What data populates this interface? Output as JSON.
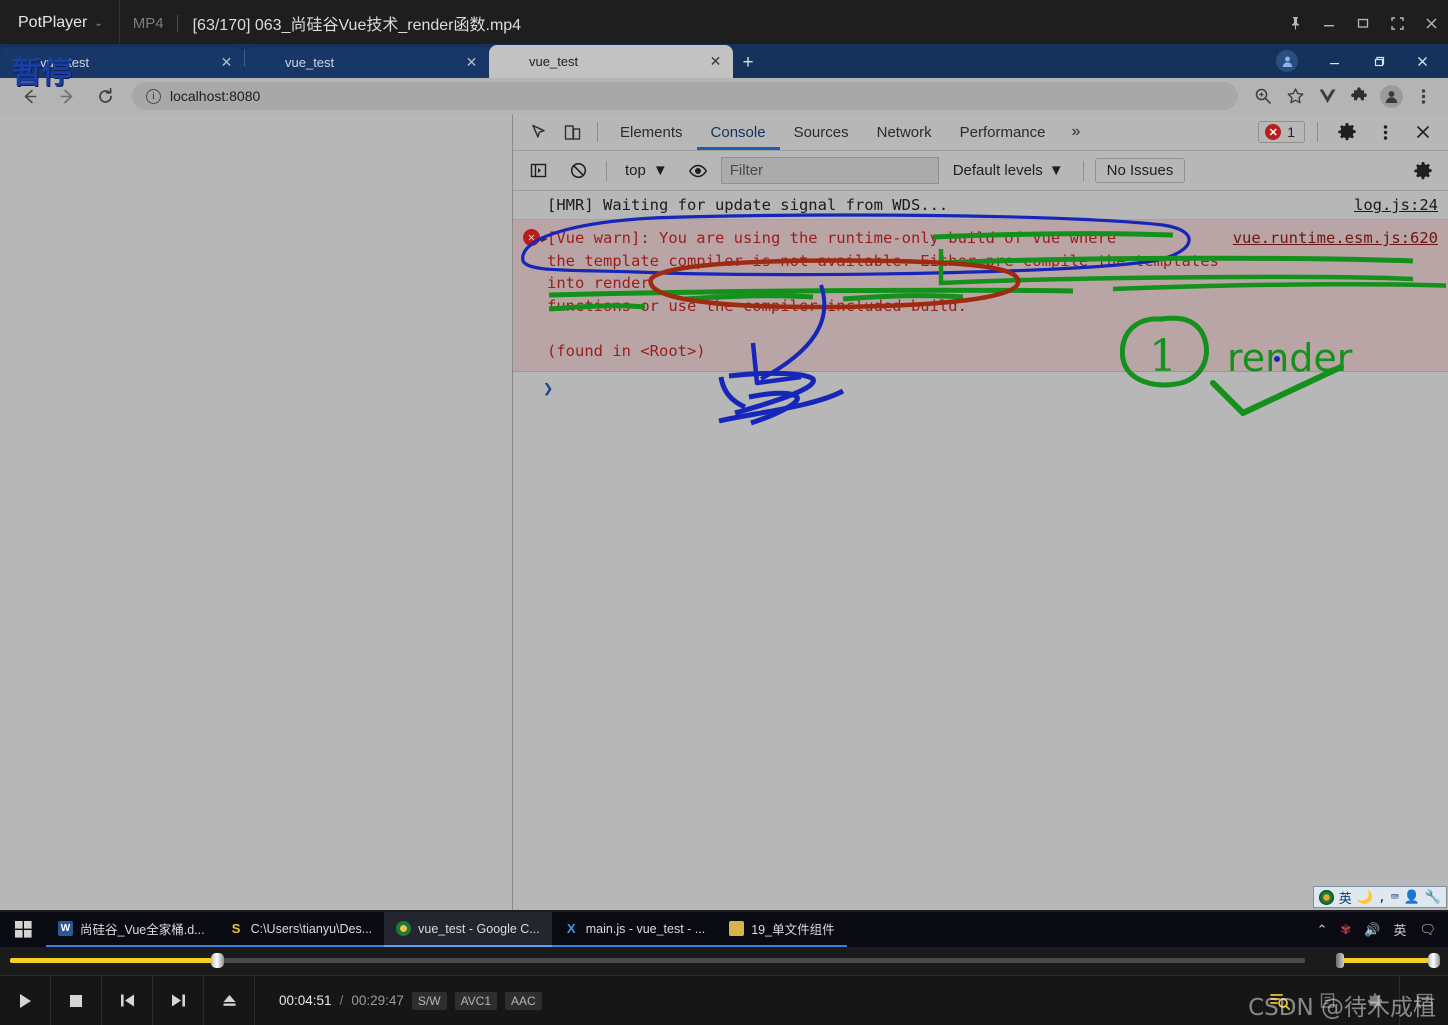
{
  "player": {
    "app_name": "PotPlayer",
    "format": "MP4",
    "filename": "[63/170] 063_尚硅谷Vue技术_render函数.mp4",
    "pause_overlay": "暂停",
    "time_current": "00:04:51",
    "time_separator": "/",
    "time_total": "00:29:47",
    "codecs": [
      "S/W",
      "AVC1",
      "AAC"
    ],
    "progress_percent": 16,
    "volume_percent": 88,
    "window_buttons": [
      "pin-icon",
      "minimize-icon",
      "maximize-icon",
      "fullscreen-icon",
      "close-icon"
    ],
    "transport": [
      "play-icon",
      "stop-icon",
      "previous-icon",
      "next-icon",
      "eject-icon"
    ],
    "watermark": "CSDN @待木成植"
  },
  "browser": {
    "tabs": [
      {
        "title": "vue_test",
        "active": false
      },
      {
        "title": "vue_test",
        "active": false
      },
      {
        "title": "vue_test",
        "active": true
      }
    ],
    "new_tab_label": "+",
    "close_label": "✕",
    "url": "localhost:8080",
    "back_label": "←",
    "forward_label": "→",
    "reload_label": "⟳",
    "omnibox_icons": [
      "zoom-icon",
      "bookmark-star-icon",
      "vue-devtools-icon",
      "extensions-puzzle-icon",
      "profile-avatar-icon",
      "chrome-menu-icon"
    ],
    "window_buttons": [
      "minimize-icon",
      "restore-icon",
      "close-icon"
    ]
  },
  "devtools": {
    "tabs": [
      {
        "label": "Elements",
        "selected": false
      },
      {
        "label": "Console",
        "selected": true
      },
      {
        "label": "Sources",
        "selected": false
      },
      {
        "label": "Network",
        "selected": false
      },
      {
        "label": "Performance",
        "selected": false
      }
    ],
    "more_tabs_label": "»",
    "error_count": "1",
    "error_glyph": "✕",
    "settings_icon": "gear-icon",
    "menu_icon": "kebab-menu-icon",
    "close_icon": "close-icon",
    "inspect_icon": "inspect-element-icon",
    "device_icon": "device-toolbar-icon",
    "console_toolbar": {
      "sidebar_icon": "console-sidebar-icon",
      "clear_icon": "clear-console-icon",
      "context": "top",
      "context_caret": "▼",
      "eye_icon": "live-expression-eye-icon",
      "filter_placeholder": "Filter",
      "filter_value": "",
      "levels_label": "Default levels",
      "levels_caret": "▼",
      "issues_label": "No Issues",
      "settings_icon": "console-settings-gear-icon"
    },
    "messages": [
      {
        "type": "info",
        "text": "[HMR] Waiting for update signal from WDS...",
        "source": "log.js:24"
      },
      {
        "type": "error",
        "expander": "▶",
        "text": "[Vue warn]: You are using the runtime-only build of Vue where\nthe template compiler is not available. Either pre-compile the templates into render\nfunctions or use the compiler-included build.\n\n(found in <Root>)",
        "source": "vue.runtime.esm.js:620"
      }
    ],
    "prompt": "❯"
  },
  "annotations": {
    "render_label": "render",
    "circle_number": "1",
    "colors": {
      "blue": "#1526b8",
      "green": "#14901c",
      "red": "#9e2b10"
    }
  },
  "ime": {
    "mode": "英",
    "icons": [
      "sogou-logo-icon",
      "moon-icon",
      "comma-icon",
      "keyboard-icon",
      "user-icon",
      "wrench-icon"
    ]
  },
  "taskbar": {
    "start_icon": "windows-start-icon",
    "items": [
      {
        "label": "尚硅谷_Vue全家桶.d...",
        "icon_letter": "W",
        "icon_color": "#2b579a",
        "state": "running"
      },
      {
        "label": "C:\\Users\\tianyu\\Des...",
        "icon_letter": "S",
        "icon_color": "#1b1b1b",
        "state": "running"
      },
      {
        "label": "vue_test - Google C...",
        "icon_letter": "",
        "icon_color": "#e8a33d",
        "state": "active"
      },
      {
        "label": "main.js - vue_test - ...",
        "icon_letter": "X",
        "icon_color": "#1b6fb8",
        "state": "running"
      },
      {
        "label": "19_单文件组件",
        "icon_letter": "",
        "icon_color": "#d8b34a",
        "state": "running"
      }
    ],
    "tray": [
      "chevron-up-icon",
      "flower-icon",
      "volume-icon",
      "英",
      "notification-icon"
    ]
  }
}
